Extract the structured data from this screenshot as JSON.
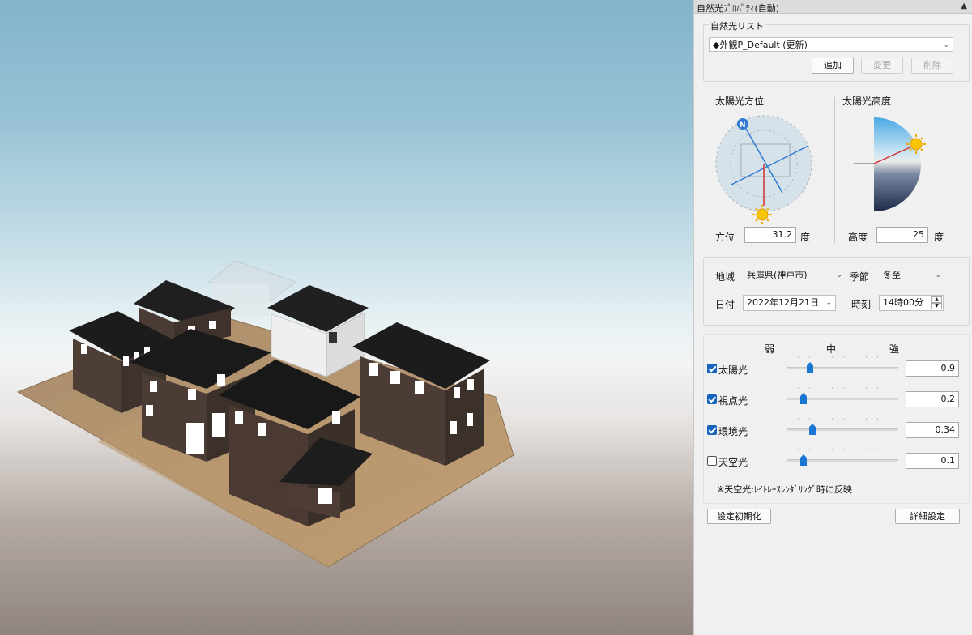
{
  "panel": {
    "title": "自然光ﾌﾟﾛﾊﾟﾃｨ(自動)",
    "list_label": "自然光リスト",
    "list_value": "◆外観P_Default (更新)",
    "buttons": {
      "add": "追加",
      "change": "変更",
      "delete": "削除"
    },
    "azimuth": {
      "title": "太陽光方位",
      "label": "方位",
      "value": "31.2",
      "unit": "度",
      "north_glyph": "N"
    },
    "altitude": {
      "title": "太陽光高度",
      "label": "高度",
      "value": "25",
      "unit": "度"
    },
    "region_label": "地域",
    "region_value": "兵庫県(神戸市)",
    "season_label": "季節",
    "season_value": "冬至",
    "date_label": "日付",
    "date_value": "2022年12月21日",
    "time_label": "時刻",
    "time_value": "14時00分",
    "scale": {
      "weak": "弱",
      "mid": "中",
      "strong": "強"
    },
    "sliders": [
      {
        "label": "太陽光",
        "checked": true,
        "value": "0.9",
        "position": 0.21
      },
      {
        "label": "視点光",
        "checked": true,
        "value": "0.2",
        "position": 0.15
      },
      {
        "label": "環境光",
        "checked": true,
        "value": "0.34",
        "position": 0.23
      },
      {
        "label": "天空光",
        "checked": false,
        "value": "0.1",
        "position": 0.15
      }
    ],
    "note": "※天空光:ﾚｲﾄﾚｰｽﾚﾝﾀﾞﾘﾝｸﾞ時に反映",
    "reset_button": "設定初期化",
    "detail_button": "詳細設定",
    "pin_icon": "pin-icon",
    "sun_icon": "sun-icon"
  },
  "colors": {
    "accent": "#1976d2",
    "panel_bg": "#f0f0f0",
    "roof": "#222222",
    "wall": "#4a3b34"
  }
}
